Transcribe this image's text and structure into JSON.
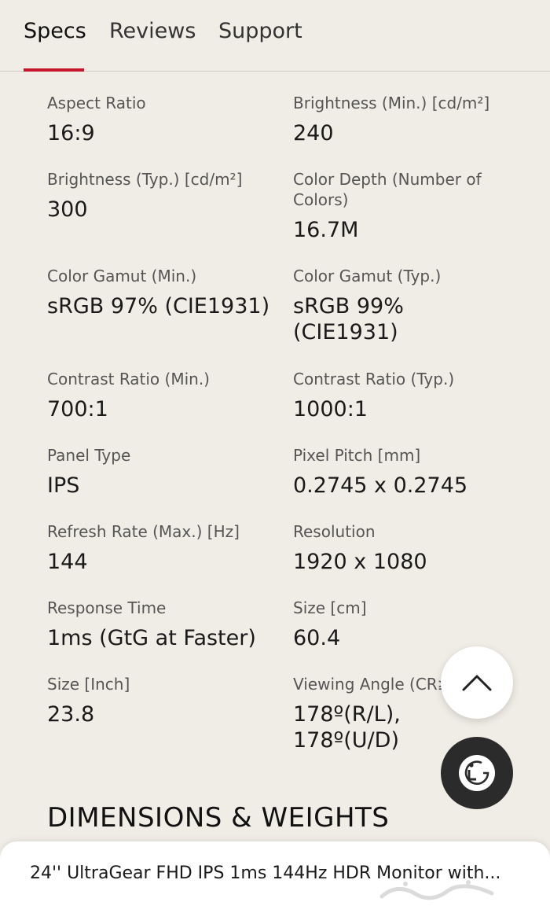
{
  "tabs": [
    {
      "label": "Specs",
      "active": true
    },
    {
      "label": "Reviews",
      "active": false
    },
    {
      "label": "Support",
      "active": false
    }
  ],
  "specs": [
    {
      "label": "Aspect Ratio",
      "value": "16:9"
    },
    {
      "label": "Brightness (Min.) [cd/m²]",
      "value": "240"
    },
    {
      "label": "Brightness (Typ.) [cd/m²]",
      "value": "300"
    },
    {
      "label": "Color Depth (Number of Colors)",
      "value": "16.7M"
    },
    {
      "label": "Color Gamut (Min.)",
      "value": "sRGB 97% (CIE1931)"
    },
    {
      "label": "Color Gamut (Typ.)",
      "value": "sRGB 99% (CIE1931)"
    },
    {
      "label": "Contrast Ratio (Min.)",
      "value": "700:1"
    },
    {
      "label": "Contrast Ratio (Typ.)",
      "value": "1000:1"
    },
    {
      "label": "Panel Type",
      "value": "IPS"
    },
    {
      "label": "Pixel Pitch [mm]",
      "value": "0.2745 x 0.2745"
    },
    {
      "label": "Refresh Rate (Max.) [Hz]",
      "value": "144"
    },
    {
      "label": "Resolution",
      "value": "1920 x 1080"
    },
    {
      "label": "Response Time",
      "value": "1ms (GtG at Faster)"
    },
    {
      "label": "Size [cm]",
      "value": "60.4"
    },
    {
      "label": "Size [Inch]",
      "value": "23.8"
    },
    {
      "label": "Viewing Angle (CR≥10)",
      "value": "178º(R/L), 178º(U/D)"
    }
  ],
  "section_heading": "DIMENSIONS & WEIGHTS",
  "product_title": "24'' UltraGear FHD IPS 1ms 144Hz HDR Monitor with...",
  "floating": {
    "scroll_top_icon": "chevron-up-icon",
    "brand_icon": "lg-logo-icon"
  },
  "colors": {
    "background": "#f0ece6",
    "accent": "#c5162b",
    "brand_button": "#2b2b2b"
  }
}
